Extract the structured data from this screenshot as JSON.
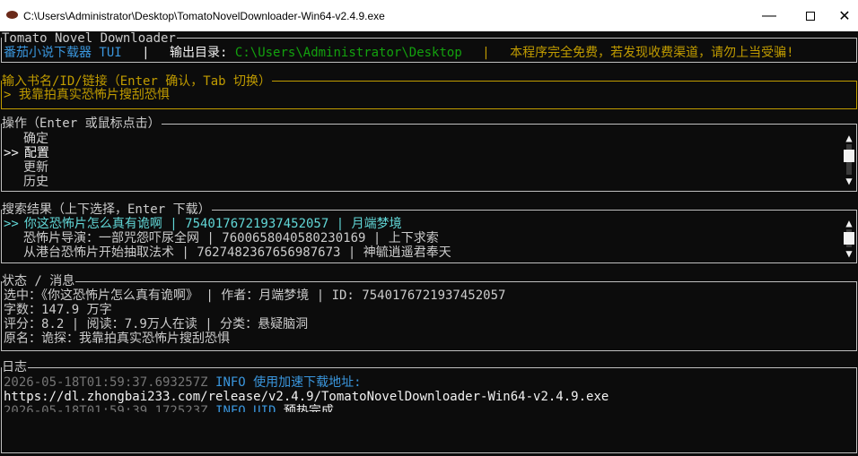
{
  "window": {
    "title": "C:\\Users\\Administrator\\Desktop\\TomatoNovelDownloader-Win64-v2.4.9.exe",
    "min_glyph": "—",
    "close_glyph": "✕"
  },
  "header": {
    "box_title": "Tomato Novel Downloader",
    "app_name": "番茄小说下载器 TUI",
    "sep1": "|",
    "output_label": "输出目录:",
    "output_path": "C:\\Users\\Administrator\\Desktop",
    "sep2": "|",
    "notice": "本程序完全免费，若发现收费渠道，请勿上当受骗!"
  },
  "input": {
    "label": "输入书名/ID/链接（Enter 确认，Tab 切换）",
    "prompt": ">",
    "value": "我靠拍真实恐怖片搜刮恐惧"
  },
  "actions": {
    "label": "操作（Enter 或鼠标点击）",
    "selected_marker": ">>",
    "items": [
      "确定",
      "配置",
      "更新",
      "历史"
    ],
    "selected_index": 1
  },
  "results": {
    "label": "搜索结果（上下选择，Enter 下载）",
    "marker": ">>",
    "rows": [
      "你这恐怖片怎么真有诡啊 | 7540176721937452057 | 月端梦境",
      "恐怖片导演：一部咒怨吓尿全网 | 7600658040580230169 | 上下求索",
      "从港台恐怖片开始抽取法术 | 7627482367656987673 | 神毓逍遥君奉天"
    ]
  },
  "status": {
    "label": "状态 / 消息",
    "lines": [
      "选中：《你这恐怖片怎么真有诡啊》 | 作者：月端梦境 | ID: 7540176721937452057",
      "字数：147.9 万字",
      "评分：8.2 | 阅读：7.9万人在读 | 分类：悬疑脑洞",
      "原名：诡探：我靠拍真实恐怖片搜刮恐惧"
    ]
  },
  "log": {
    "label": "日志",
    "entries": [
      {
        "time": "2026-05-18T01:59:37.693257Z",
        "level": "INFO",
        "msg": "使用加速下载地址:"
      },
      {
        "url": "https://dl.zhongbai233.com/release/v2.4.9/TomatoNovelDownloader-Win64-v2.4.9.exe"
      },
      {
        "time": "2026-05-18T01:59:39.172523Z",
        "level": "INFO UID",
        "msg": "预热完成"
      }
    ]
  },
  "scroll_glyphs": {
    "up": "▲",
    "down": "▼"
  },
  "colors": {
    "background": "#0c0c0c",
    "accent_cyan": "#3a96dd",
    "teal": "#61d6d6",
    "green": "#13a10e",
    "yellow": "#c19c00",
    "white": "#f2f2f2",
    "grey": "#767676"
  }
}
